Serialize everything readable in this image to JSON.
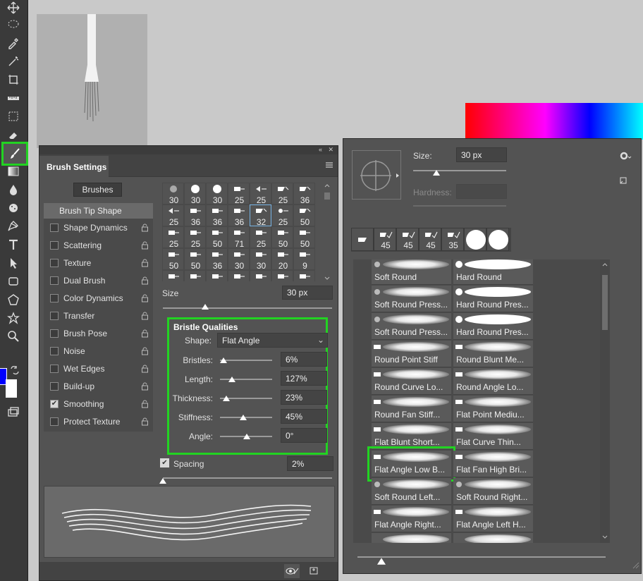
{
  "toolbar": {
    "tools": [
      "move-icon",
      "lasso-icon",
      "eyedropper-icon",
      "magic-wand-icon",
      "crop-icon",
      "ruler-icon",
      "marquee-icon",
      "eraser-icon",
      "brush-icon",
      "gradient-icon",
      "blur-drop-icon",
      "sponge-icon",
      "pen-icon",
      "type-icon",
      "selection-arrow-icon",
      "rectangle-icon",
      "polygon-icon",
      "custom-shape-icon",
      "zoom-icon"
    ],
    "foreground_color": "#0000ff",
    "background_color": "#ffffff"
  },
  "brush_settings": {
    "tab_title": "Brush Settings",
    "brushes_button": "Brushes",
    "options_header": "Brush Tip Shape",
    "options": [
      {
        "label": "Shape Dynamics",
        "checked": false
      },
      {
        "label": "Scattering",
        "checked": false
      },
      {
        "label": "Texture",
        "checked": false
      },
      {
        "label": "Dual Brush",
        "checked": false
      },
      {
        "label": "Color Dynamics",
        "checked": false
      },
      {
        "label": "Transfer",
        "checked": false
      },
      {
        "label": "Brush Pose",
        "checked": false
      },
      {
        "label": "Noise",
        "checked": false
      },
      {
        "label": "Wet Edges",
        "checked": false
      },
      {
        "label": "Build-up",
        "checked": false
      },
      {
        "label": "Smoothing",
        "checked": true
      },
      {
        "label": "Protect Texture",
        "checked": false
      }
    ],
    "preset_grid": [
      [
        "30",
        "30",
        "30",
        "25",
        "25",
        "25",
        "36"
      ],
      [
        "25",
        "36",
        "36",
        "36",
        "32",
        "25",
        "50"
      ],
      [
        "25",
        "25",
        "50",
        "71",
        "25",
        "50",
        "50"
      ],
      [
        "50",
        "50",
        "36",
        "30",
        "30",
        "20",
        "9"
      ]
    ],
    "size_label": "Size",
    "size_value": "30 px",
    "bristle": {
      "title": "Bristle Qualities",
      "shape_label": "Shape:",
      "shape_value": "Flat Angle",
      "bristles_label": "Bristles:",
      "bristles_value": "6%",
      "length_label": "Length:",
      "length_value": "127%",
      "thickness_label": "Thickness:",
      "thickness_value": "23%",
      "stiffness_label": "Stiffness:",
      "stiffness_value": "45%",
      "angle_label": "Angle:",
      "angle_value": "0°"
    },
    "spacing_label": "Spacing",
    "spacing_value": "2%"
  },
  "picker": {
    "size_label": "Size:",
    "size_value": "30 px",
    "hardness_label": "Hardness:",
    "recent": [
      "45",
      "45",
      "45",
      "35"
    ],
    "brushes": [
      [
        "Soft Round",
        "Hard Round"
      ],
      [
        "Soft Round Press...",
        "Hard Round Pres..."
      ],
      [
        "Soft Round Press...",
        "Hard Round Pres..."
      ],
      [
        "Round Point Stiff",
        "Round Blunt Me..."
      ],
      [
        "Round Curve Lo...",
        "Round Angle Lo..."
      ],
      [
        "Round Fan Stiff...",
        "Flat Point Mediu..."
      ],
      [
        "Flat Blunt Short...",
        "Flat Curve Thin..."
      ],
      [
        "Flat Angle Low B...",
        "Flat Fan High Bri..."
      ],
      [
        "Soft Round Left...",
        "Soft Round Right..."
      ],
      [
        "Flat Angle Right...",
        "Flat Angle Left H..."
      ]
    ]
  }
}
